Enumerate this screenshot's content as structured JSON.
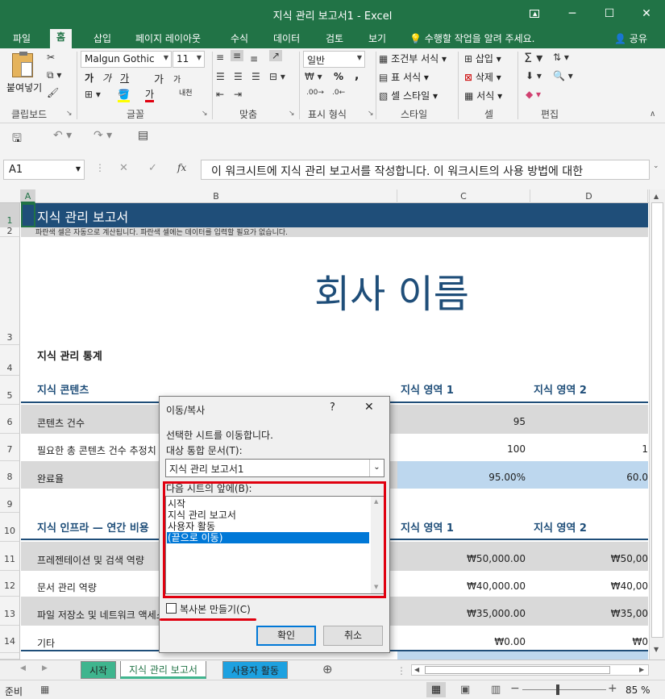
{
  "window": {
    "title": "지식 관리 보고서1 - Excel",
    "controls": {
      "restore_icon": "ribbon-display-icon",
      "minimize": "─",
      "maximize": "☐",
      "close": "✕"
    }
  },
  "ribbon": {
    "tabs": [
      "파일",
      "홈",
      "삽입",
      "페이지 레이아웃",
      "수식",
      "데이터",
      "검토",
      "보기"
    ],
    "active_tab": "홈",
    "tell_me": "수행할 작업을 알려 주세요.",
    "share": "공유",
    "clipboard": {
      "paste": "붙여넣기",
      "label": "클립보드"
    },
    "font": {
      "name": "Malgun Gothic",
      "size": "11",
      "label": "글꼴",
      "bold": "가",
      "italic": "가",
      "underline": "가",
      "grow": "가",
      "shrink": "가",
      "font_color": "가",
      "phonetic": "내천"
    },
    "alignment": {
      "label": "맞춤"
    },
    "number": {
      "format": "일반",
      "label": "표시 형식",
      "percent": "%",
      "comma": ","
    },
    "styles": {
      "conditional": "조건부 서식",
      "table": "표 서식",
      "cell": "셀 스타일",
      "label": "스타일"
    },
    "cells": {
      "insert": "삽입",
      "delete": "삭제",
      "format": "서식",
      "label": "셀"
    },
    "editing": {
      "label": "편집"
    }
  },
  "formula_bar": {
    "name_box": "A1",
    "fx": "fx",
    "content": "이 워크시트에 지식 관리 보고서를 작성합니다. 이 워크시트의 사용 방법에 대한"
  },
  "columns": [
    "A",
    "B",
    "C",
    "D"
  ],
  "rows": [
    "1",
    "2",
    "3",
    "4",
    "5",
    "6",
    "7",
    "8",
    "9",
    "10",
    "11",
    "12",
    "13",
    "14"
  ],
  "sheet": {
    "title": "지식 관리 보고서",
    "note": "파란색 셀은 자동으로 계산됩니다. 파란색 셀에는 데이터를 입력할 필요가 없습니다.",
    "company": "회사 이름",
    "stats_heading": "지식 관리 통계",
    "content_header": {
      "label": "지식 콘텐츠",
      "c": "지식 영역 1",
      "d": "지식 영역 2"
    },
    "r6": {
      "label": "콘텐츠 건수",
      "c": "95"
    },
    "r7": {
      "label": "필요한 총 콘텐츠 건수 추정치",
      "c": "100",
      "d": "1"
    },
    "r8": {
      "label": "완료율",
      "c": "95.00%",
      "d": "60.0"
    },
    "infra_header": {
      "label": "지식 인프라 — 연간 비용",
      "c": "지식 영역 1",
      "d": "지식 영역 2"
    },
    "r11": {
      "label": "프레젠테이션 및 검색 역량",
      "c": "₩50,000.00",
      "d": "₩50,00"
    },
    "r12": {
      "label": "문서 관리 역량",
      "c": "₩40,000.00",
      "d": "₩40,00"
    },
    "r13": {
      "label": "파일 저장소 및 네트워크 액세스",
      "c": "₩35,000.00",
      "d": "₩35,00"
    },
    "r14": {
      "label": "기타",
      "c": "₩0.00",
      "d": "₩0"
    }
  },
  "dialog": {
    "title": "이동/복사",
    "help": "?",
    "close": "✕",
    "instruction": "선택한 시트를 이동합니다.",
    "target_label": "대상 통합 문서(T):",
    "target_value": "지식 관리 보고서1",
    "before_label": "다음 시트의 앞에(B):",
    "list": [
      "시작",
      "지식 관리 보고서",
      "사용자 활동",
      "(끝으로 이동)"
    ],
    "selected_index": 3,
    "copy_label": "복사본 만들기(C)",
    "ok": "확인",
    "cancel": "취소"
  },
  "sheet_tabs": [
    {
      "name": "시작",
      "color": "#3fb58e"
    },
    {
      "name": "지식 관리 보고서",
      "color": "#3fb58e"
    },
    {
      "name": "사용자 활동",
      "color": "#1da1e0"
    }
  ],
  "status": {
    "ready": "준비",
    "zoom": "85 %"
  },
  "colors": {
    "excel_green": "#217346",
    "title_band": "#1f4e79",
    "gray_band": "#d9d9d9",
    "blue_band": "#bdd7ee",
    "highlight": "#e0000f"
  }
}
